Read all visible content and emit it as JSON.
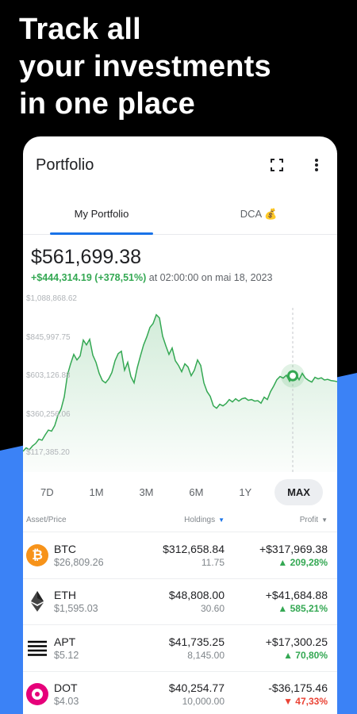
{
  "headline": {
    "line1": "Track all",
    "line2": "your investments",
    "line3": "in one place"
  },
  "colors": {
    "accent": "#1a73e8",
    "positive": "#34a853",
    "negative": "#ea4335",
    "background": "#000000",
    "bottom_band": "#3b82f6"
  },
  "appbar": {
    "title": "Portfolio",
    "icons": [
      "fullscreen-icon",
      "more-vert-icon"
    ]
  },
  "tabs": [
    {
      "label": "My Portfolio",
      "active": true
    },
    {
      "label": "DCA 💰",
      "active": false
    }
  ],
  "portfolio": {
    "total": "$561,699.38",
    "change": "+$444,314.19 (+378,51%)",
    "timestamp": "at 02:00:00 on mai 18, 2023"
  },
  "chart_data": {
    "type": "area",
    "y_tick_labels": [
      "$1,088,868.62",
      "$845,997.75",
      "$603,126.88",
      "$360,256.06",
      "$117,385.20"
    ],
    "ylim": [
      117385.2,
      1088868.62
    ],
    "x": [
      0,
      1,
      2,
      3,
      4,
      5,
      6,
      7,
      8,
      9,
      10,
      11,
      12,
      13,
      14,
      15,
      16,
      17,
      18,
      19,
      20,
      21,
      22,
      23,
      24,
      25,
      26,
      27,
      28,
      29,
      30,
      31,
      32,
      33,
      34,
      35,
      36,
      37,
      38,
      39,
      40,
      41,
      42,
      43,
      44,
      45,
      46,
      47,
      48,
      49,
      50,
      51,
      52,
      53,
      54,
      55,
      56,
      57,
      58,
      59,
      60,
      61,
      62,
      63,
      64,
      65,
      66,
      67,
      68,
      69,
      70,
      71,
      72,
      73,
      74,
      75,
      76,
      77,
      78,
      79,
      80,
      81,
      82,
      83,
      84,
      85,
      86,
      87,
      88,
      89,
      90,
      91,
      92,
      93,
      94,
      95,
      96,
      97,
      98,
      99
    ],
    "values": [
      128000,
      150000,
      138000,
      162000,
      178000,
      205000,
      198000,
      232000,
      262000,
      255000,
      290000,
      355000,
      395000,
      472000,
      610000,
      680000,
      740000,
      705000,
      730000,
      830000,
      800000,
      835000,
      735000,
      690000,
      620000,
      575000,
      560000,
      585000,
      625000,
      700000,
      745000,
      760000,
      640000,
      690000,
      600000,
      560000,
      655000,
      730000,
      800000,
      850000,
      910000,
      935000,
      990000,
      970000,
      855000,
      795000,
      740000,
      780000,
      700000,
      670000,
      630000,
      680000,
      660000,
      605000,
      640000,
      705000,
      670000,
      560000,
      505000,
      475000,
      415000,
      400000,
      425000,
      415000,
      430000,
      455000,
      440000,
      460000,
      445000,
      460000,
      465000,
      450000,
      455000,
      445000,
      448000,
      432000,
      470000,
      455000,
      505000,
      540000,
      580000,
      600000,
      590000,
      608000,
      570000,
      605000,
      615000,
      580000,
      620000,
      590000,
      575000,
      565000,
      595000,
      585000,
      592000,
      578000,
      582000,
      575000,
      572000,
      568000
    ],
    "highlight_index": 85,
    "grid": false,
    "ranges": [
      "7D",
      "1M",
      "3M",
      "6M",
      "1Y",
      "MAX"
    ],
    "selected_range": "MAX"
  },
  "table": {
    "headers": {
      "asset": "Asset/Price",
      "holdings": "Holdings",
      "profit": "Profit"
    },
    "rows": [
      {
        "symbol": "BTC",
        "price": "$26,809.26",
        "holdings_value": "$312,658.84",
        "holdings_qty": "11.75",
        "profit": "+$317,969.38",
        "profit_pct": "▲ 209,28%",
        "trend": "up",
        "icon": "bitcoin-icon",
        "icon_color": "#f7931a"
      },
      {
        "symbol": "ETH",
        "price": "$1,595.03",
        "holdings_value": "$48,808.00",
        "holdings_qty": "30.60",
        "profit": "+$41,684.88",
        "profit_pct": "▲ 585,21%",
        "trend": "up",
        "icon": "ethereum-icon",
        "icon_color": "#627eea"
      },
      {
        "symbol": "APT",
        "price": "$5.12",
        "holdings_value": "$41,735.25",
        "holdings_qty": "8,145.00",
        "profit": "+$17,300.25",
        "profit_pct": "▲ 70,80%",
        "trend": "up",
        "icon": "aptos-icon",
        "icon_color": "#000000"
      },
      {
        "symbol": "DOT",
        "price": "$4.03",
        "holdings_value": "$40,254.77",
        "holdings_qty": "10,000.00",
        "profit": "-$36,175.46",
        "profit_pct": "▼ 47,33%",
        "trend": "down",
        "icon": "polkadot-icon",
        "icon_color": "#e6007a"
      }
    ]
  }
}
